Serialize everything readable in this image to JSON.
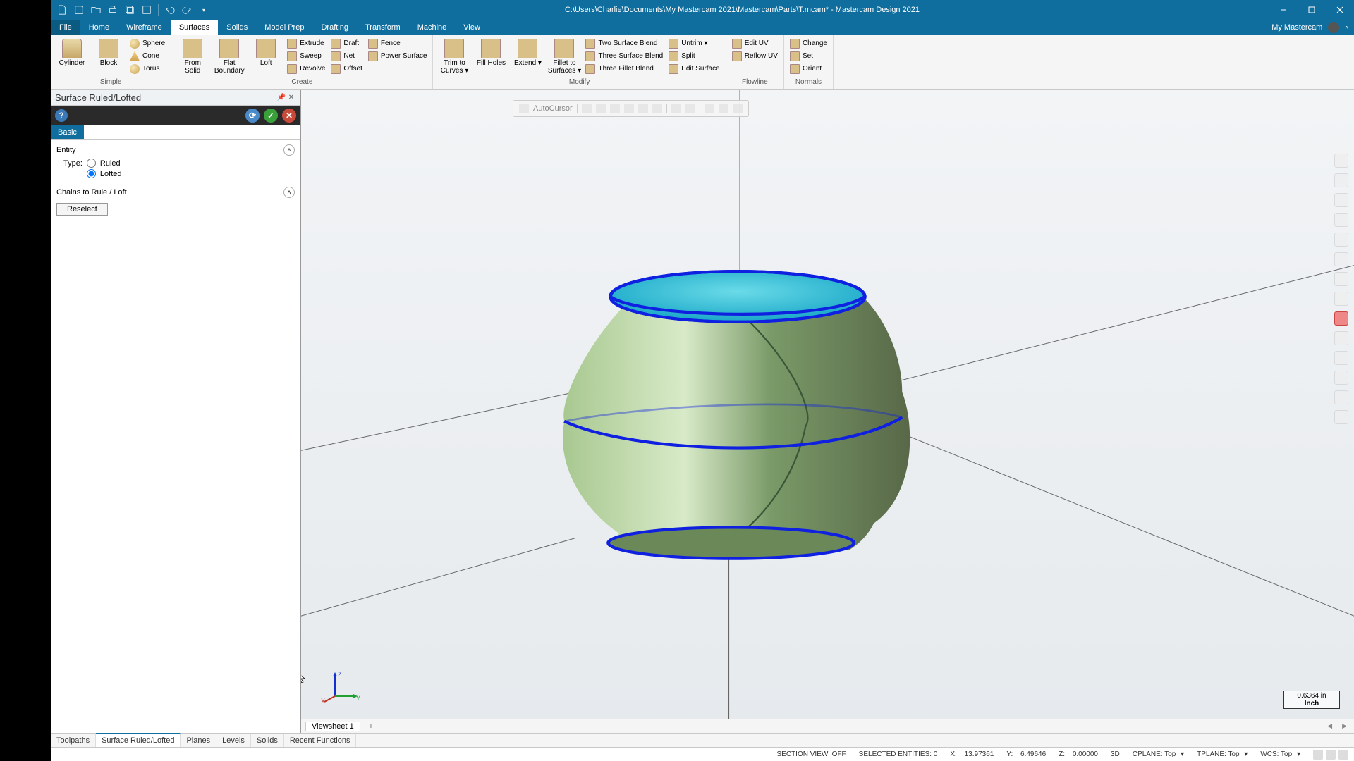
{
  "title": "C:\\Users\\Charlie\\Documents\\My Mastercam 2021\\Mastercam\\Parts\\T.mcam* - Mastercam Design 2021",
  "tabs": {
    "file": "File",
    "items": [
      "Home",
      "Wireframe",
      "Surfaces",
      "Solids",
      "Model Prep",
      "Drafting",
      "Transform",
      "Machine",
      "View"
    ],
    "active": "Surfaces",
    "right": "My Mastercam"
  },
  "ribbon": {
    "groups": {
      "simple": {
        "label": "Simple",
        "big": [
          "Cylinder",
          "Block"
        ],
        "small": [
          "Sphere",
          "Cone",
          "Torus"
        ]
      },
      "create": {
        "label": "Create",
        "big": [
          "From Solid",
          "Flat Boundary",
          "Loft"
        ],
        "col1": [
          "Extrude",
          "Sweep",
          "Revolve"
        ],
        "col2": [
          "Draft",
          "Net",
          "Offset"
        ],
        "col3": [
          "Fence",
          "Power Surface"
        ]
      },
      "modify": {
        "label": "Modify",
        "big": [
          "Trim to Curves ▾",
          "Fill Holes",
          "Extend ▾",
          "Fillet to Surfaces ▾"
        ],
        "col1": [
          "Two Surface Blend",
          "Three Surface Blend",
          "Three Fillet Blend"
        ],
        "col2": [
          "Untrim ▾",
          "Split",
          "Edit Surface"
        ]
      },
      "flowline": {
        "label": "Flowline",
        "items": [
          "Edit UV",
          "Reflow UV"
        ]
      },
      "normals": {
        "label": "Normals",
        "items": [
          "Change",
          "Set",
          "Orient"
        ]
      }
    }
  },
  "panel": {
    "title": "Surface Ruled/Lofted",
    "basic": "Basic",
    "entity": "Entity",
    "type_label": "Type:",
    "ruled": "Ruled",
    "lofted": "Lofted",
    "chains": "Chains to Rule / Loft",
    "reselect": "Reselect"
  },
  "bottom_tabs": [
    "Toolpaths",
    "Surface Ruled/Lofted",
    "Planes",
    "Levels",
    "Solids",
    "Recent Functions"
  ],
  "bottom_active": "Surface Ruled/Lofted",
  "viewsheet": "Viewsheet 1",
  "floatbar": "AutoCursor",
  "scale": {
    "value": "0.6364 in",
    "unit": "Inch"
  },
  "status": {
    "section": "SECTION VIEW: OFF",
    "sel": "SELECTED ENTITIES: 0",
    "x_label": "X:",
    "x": "13.97361",
    "y_label": "Y:",
    "y": "6.49646",
    "z_label": "Z:",
    "z": "0.00000",
    "mode": "3D",
    "cplane": "CPLANE: Top",
    "tplane": "TPLANE: Top",
    "wcs": "WCS: Top"
  },
  "gnomon": {
    "x": "X",
    "y": "Y",
    "z": "Z"
  }
}
